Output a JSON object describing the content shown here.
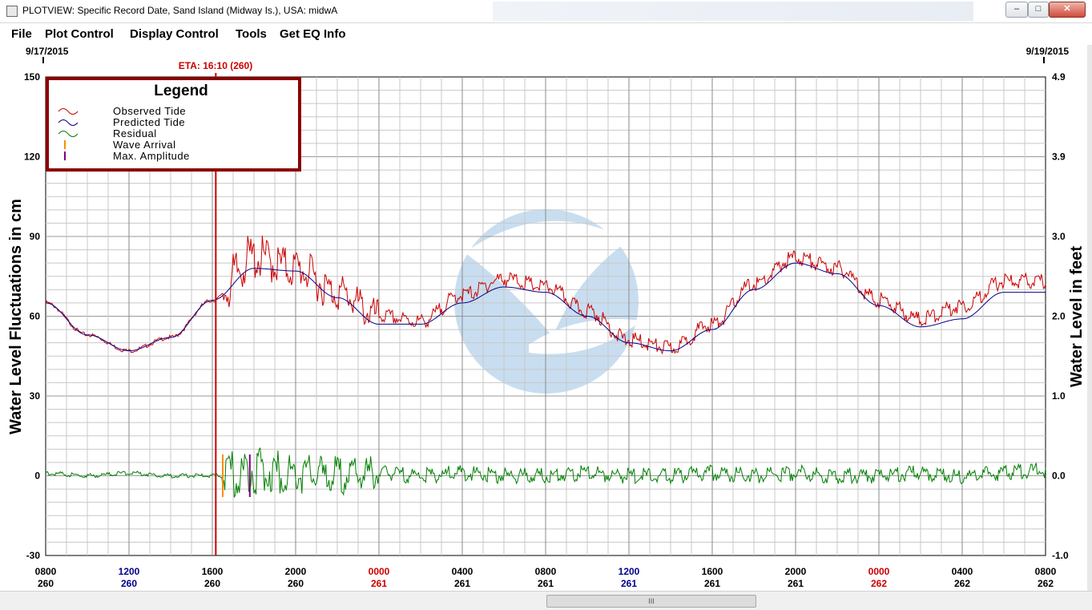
{
  "window": {
    "title": "PLOTVIEW: Specific Record Date, Sand Island (Midway Is.), USA: midwA",
    "minimize": "–",
    "maximize": "□",
    "close": "✕"
  },
  "menu": [
    "File",
    "Plot Control",
    "Display Control",
    "Tools",
    "Get EQ Info"
  ],
  "scroll": {
    "thumb_label": "III"
  },
  "chart_data": {
    "type": "line",
    "start_date": "9/17/2015",
    "end_date": "9/19/2015",
    "eta_label": "ETA: 16:10 (260)",
    "eta_hour": 16.167,
    "ylabel_left": "Water Level Fluctuations in cm",
    "ylabel_right": "Water Level in feet",
    "ylim": [
      -30,
      150
    ],
    "yticks_left": [
      "150",
      "120",
      "90",
      "60",
      "30",
      "0",
      "-30"
    ],
    "yticks_right": [
      "4.9",
      "3.9",
      "3.0",
      "2.0",
      "1.0",
      "0.0",
      "-1.0"
    ],
    "x_range_hours": [
      8,
      56
    ],
    "x_ticks": [
      {
        "time": "0800",
        "day": "260",
        "time_color": "#000000",
        "day_color": "#000000"
      },
      {
        "time": "1200",
        "day": "260",
        "time_color": "#00008b",
        "day_color": "#00008b"
      },
      {
        "time": "1600",
        "day": "260",
        "time_color": "#000000",
        "day_color": "#000000"
      },
      {
        "time": "2000",
        "day": "260",
        "time_color": "#000000",
        "day_color": "#000000"
      },
      {
        "time": "0000",
        "day": "261",
        "time_color": "#cc0000",
        "day_color": "#cc0000"
      },
      {
        "time": "0400",
        "day": "261",
        "time_color": "#000000",
        "day_color": "#000000"
      },
      {
        "time": "0800",
        "day": "261",
        "time_color": "#000000",
        "day_color": "#000000"
      },
      {
        "time": "1200",
        "day": "261",
        "time_color": "#00008b",
        "day_color": "#00008b"
      },
      {
        "time": "1600",
        "day": "261",
        "time_color": "#000000",
        "day_color": "#000000"
      },
      {
        "time": "2000",
        "day": "261",
        "time_color": "#000000",
        "day_color": "#000000"
      },
      {
        "time": "0000",
        "day": "262",
        "time_color": "#cc0000",
        "day_color": "#cc0000"
      },
      {
        "time": "0400",
        "day": "262",
        "time_color": "#000000",
        "day_color": "#000000"
      },
      {
        "time": "0800",
        "day": "262",
        "time_color": "#000000",
        "day_color": "#000000"
      }
    ],
    "legend": {
      "title": "Legend",
      "position": "top-left",
      "entries": [
        {
          "label": "Observed Tide",
          "color": "#cc0000",
          "symbol": "wave"
        },
        {
          "label": "Predicted Tide",
          "color": "#00008b",
          "symbol": "wave"
        },
        {
          "label": "Residual",
          "color": "#008000",
          "symbol": "wave"
        },
        {
          "label": "Wave Arrival",
          "color": "#ff8c00",
          "symbol": "bar"
        },
        {
          "label": "Max. Amplitude",
          "color": "#800080",
          "symbol": "bar"
        }
      ]
    },
    "series": [
      {
        "name": "Predicted Tide",
        "color": "#00008b",
        "hours": [
          8,
          10,
          12,
          14,
          16,
          18,
          20,
          22,
          24,
          26,
          28,
          30,
          32,
          34,
          36,
          38,
          40,
          42,
          44,
          46,
          48,
          50,
          52,
          54,
          56
        ],
        "values": [
          65,
          53,
          47,
          52,
          66,
          78,
          77,
          67,
          57,
          57,
          65,
          71,
          69,
          60,
          50,
          47,
          55,
          70,
          80,
          76,
          64,
          56,
          59,
          69,
          69
        ]
      },
      {
        "name": "Observed Tide",
        "color": "#cc0000",
        "hours": [
          8,
          10,
          12,
          14,
          16,
          18,
          20,
          22,
          24,
          26,
          28,
          30,
          32,
          34,
          36,
          38,
          40,
          42,
          44,
          46,
          48,
          50,
          52,
          54,
          56
        ],
        "values": [
          65,
          53,
          47,
          52,
          66,
          82,
          78,
          69,
          60,
          58,
          68,
          74,
          71,
          62,
          51,
          48,
          57,
          72,
          82,
          78,
          66,
          59,
          64,
          73,
          73
        ]
      },
      {
        "name": "Residual",
        "color": "#008000",
        "hours": [
          8,
          10,
          12,
          14,
          16,
          17,
          18,
          20,
          22,
          24,
          26,
          28,
          30,
          32,
          34,
          36,
          38,
          40,
          42,
          44,
          46,
          48,
          50,
          52,
          54,
          56
        ],
        "values": [
          1,
          0,
          1,
          0,
          0,
          0,
          2,
          1,
          0,
          1,
          0,
          1,
          0,
          0,
          1,
          0,
          0,
          1,
          0,
          1,
          0,
          0,
          1,
          0,
          1,
          2
        ]
      }
    ],
    "wave_arrival_hour": 16.5,
    "max_amplitude_hour": 17.8,
    "grid": true
  }
}
